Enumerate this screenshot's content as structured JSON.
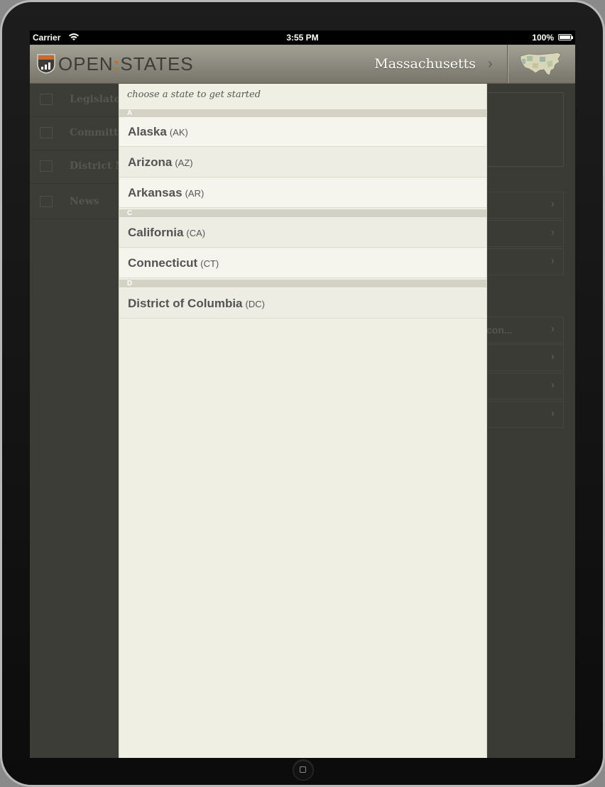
{
  "status_bar": {
    "carrier": "Carrier",
    "time": "3:55 PM",
    "battery": "100%"
  },
  "navbar": {
    "logo_left": "OPEN",
    "logo_sep": ":",
    "logo_right": "STATES",
    "current_state": "Massachusetts",
    "chevron": "›",
    "map_icon": "us-map-icon"
  },
  "background": {
    "sidebar": [
      {
        "label": "Legislato"
      },
      {
        "label": "Committe"
      },
      {
        "label": "District M"
      },
      {
        "label": "News"
      }
    ],
    "rows_group1": [
      "",
      "",
      ""
    ],
    "rows_group2": [
      "con...",
      "",
      "",
      ""
    ],
    "chevron": "›"
  },
  "picker": {
    "header": "choose a state to get started",
    "sections": [
      {
        "letter": "A",
        "states": [
          {
            "name": "Alaska",
            "abbr": "(AK)"
          },
          {
            "name": "Arizona",
            "abbr": "(AZ)"
          },
          {
            "name": "Arkansas",
            "abbr": "(AR)"
          }
        ]
      },
      {
        "letter": "C",
        "states": [
          {
            "name": "California",
            "abbr": "(CA)"
          },
          {
            "name": "Connecticut",
            "abbr": "(CT)"
          }
        ]
      },
      {
        "letter": "D",
        "states": [
          {
            "name": "District of Columbia",
            "abbr": "(DC)"
          }
        ]
      }
    ]
  },
  "colors": {
    "accent": "#c8692d",
    "navbar_top": "#a3a194",
    "navbar_bottom": "#77756a",
    "list_bg": "#efefe3"
  }
}
